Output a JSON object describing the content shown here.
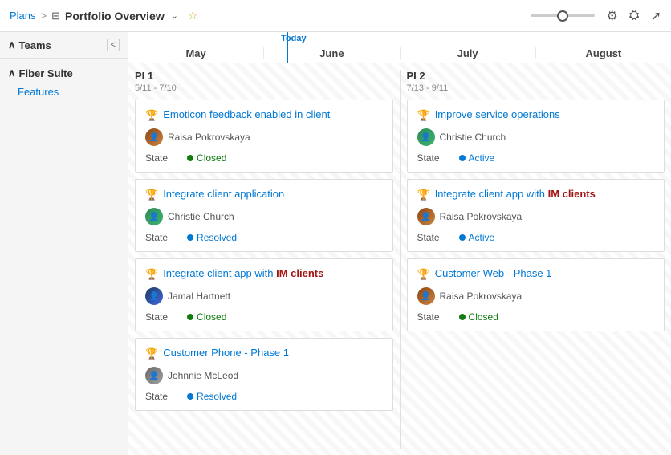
{
  "header": {
    "breadcrumb_plans": "Plans",
    "breadcrumb_sep": ">",
    "breadcrumb_icon": "⊟",
    "breadcrumb_title": "Portfolio Overview",
    "breadcrumb_chevron": "∨",
    "breadcrumb_star": "☆",
    "settings_icon": "⚙",
    "filter_icon": "⊤",
    "expand_icon": "⤢"
  },
  "sidebar": {
    "teams_label": "Teams",
    "collapse_btn": "<",
    "group_label": "Fiber Suite",
    "group_item": "Features"
  },
  "timeline": {
    "today_label": "Today",
    "months": [
      "May",
      "June",
      "July",
      "August"
    ]
  },
  "pi1": {
    "title": "PI 1",
    "dates": "5/11 - 7/10",
    "cards": [
      {
        "id": "card-1",
        "title": "Emoticon feedback enabled in client",
        "person": "Raisa Pokrovskaya",
        "avatar_type": "raisa",
        "avatar_text": "RP",
        "state_label": "State",
        "state": "Closed",
        "state_type": "closed"
      },
      {
        "id": "card-2",
        "title": "Integrate client application",
        "person": "Christie Church",
        "avatar_type": "christie",
        "avatar_text": "CC",
        "state_label": "State",
        "state": "Resolved",
        "state_type": "resolved"
      },
      {
        "id": "card-3",
        "title": "Integrate client app with IM clients",
        "person": "Jamal Hartnett",
        "avatar_type": "jamal",
        "avatar_text": "JH",
        "state_label": "State",
        "state": "Closed",
        "state_type": "closed"
      },
      {
        "id": "card-4",
        "title": "Customer Phone - Phase 1",
        "person": "Johnnie McLeod",
        "avatar_type": "johnnie",
        "avatar_text": "JM",
        "state_label": "State",
        "state": "Resolved",
        "state_type": "resolved"
      }
    ]
  },
  "pi2": {
    "title": "PI 2",
    "dates": "7/13 - 9/11",
    "cards": [
      {
        "id": "card-5",
        "title": "Improve service operations",
        "person": "Christie Church",
        "avatar_type": "christie",
        "avatar_text": "CC",
        "state_label": "State",
        "state": "Active",
        "state_type": "active"
      },
      {
        "id": "card-6",
        "title": "Integrate client app with IM clients",
        "person": "Raisa Pokrovskaya",
        "avatar_type": "raisa",
        "avatar_text": "RP",
        "state_label": "State",
        "state": "Active",
        "state_type": "active"
      },
      {
        "id": "card-7",
        "title": "Customer Web - Phase 1",
        "person": "Raisa Pokrovskaya",
        "avatar_type": "raisa",
        "avatar_text": "RP",
        "state_label": "State",
        "state": "Closed",
        "state_type": "closed"
      }
    ]
  }
}
